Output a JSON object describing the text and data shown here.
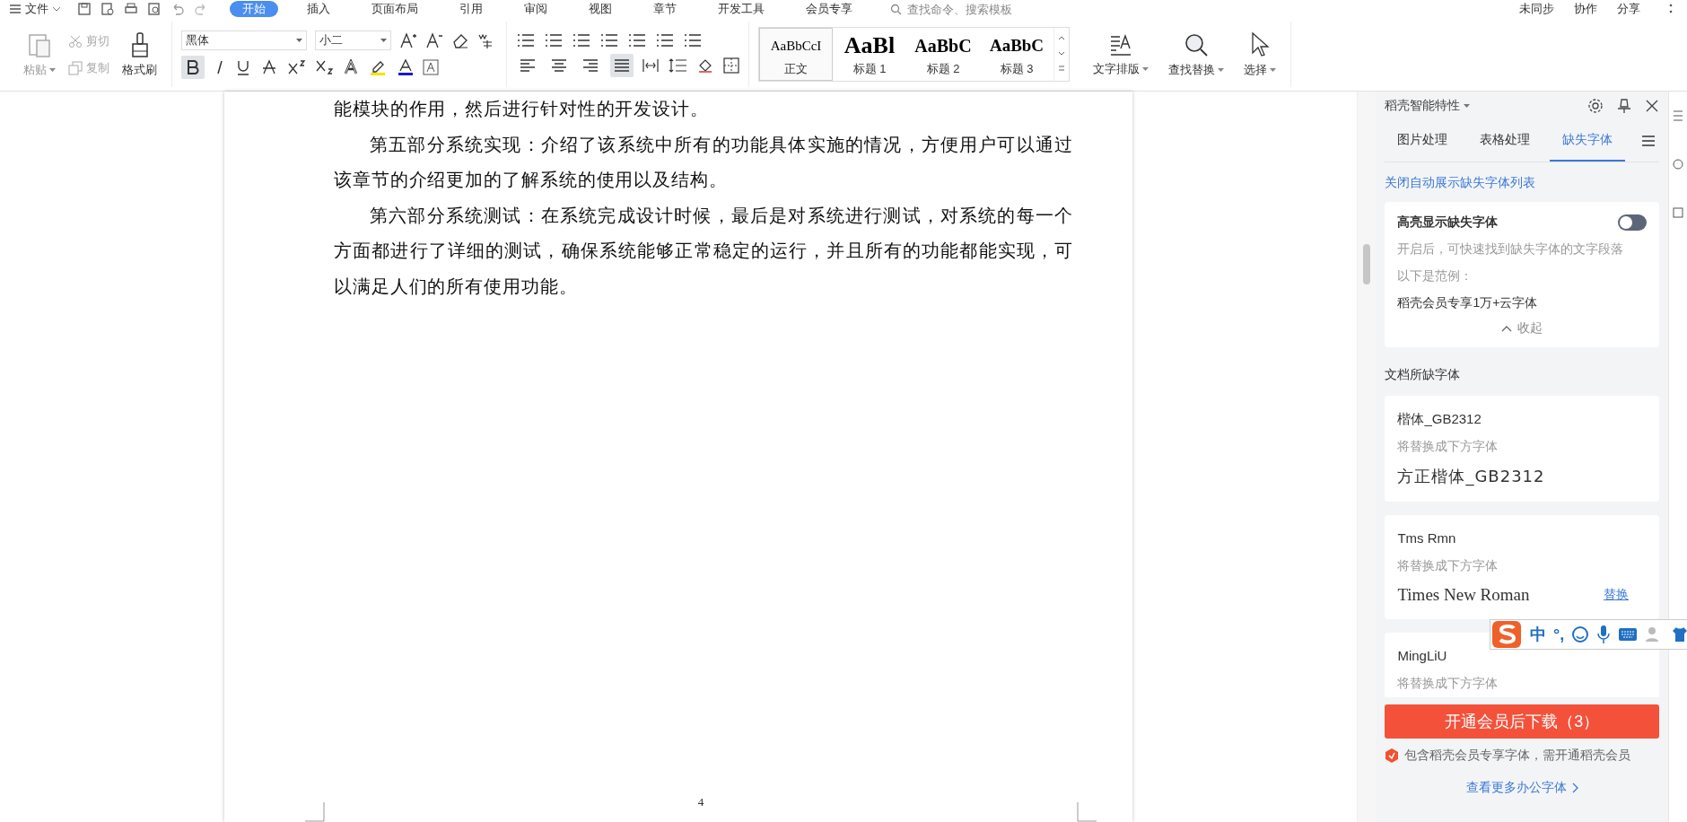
{
  "menu_bar": {
    "file_menu": "文件",
    "tabs": [
      {
        "label": "开始",
        "selected": true
      },
      {
        "label": "插入",
        "selected": false
      },
      {
        "label": "页面布局",
        "selected": false
      },
      {
        "label": "引用",
        "selected": false
      },
      {
        "label": "审阅",
        "selected": false
      },
      {
        "label": "视图",
        "selected": false
      },
      {
        "label": "章节",
        "selected": false
      },
      {
        "label": "开发工具",
        "selected": false
      },
      {
        "label": "会员专享",
        "selected": false
      }
    ],
    "search": {
      "placeholder": "查找命令、搜索模板"
    },
    "actions": [
      "未同步",
      "协作",
      "分享"
    ]
  },
  "ribbon": {
    "paste": "粘贴",
    "cut": {
      "label": "剪切",
      "disabled": true
    },
    "copy": {
      "label": "复制",
      "disabled": true
    },
    "format_painter": "格式刷",
    "font_name": "黑体",
    "font_size": "小二",
    "bold": true,
    "alignments": [
      {
        "kind": "left",
        "selected": false
      },
      {
        "kind": "center",
        "selected": false
      },
      {
        "kind": "right",
        "selected": false
      },
      {
        "kind": "justify",
        "selected": true
      }
    ],
    "styles": [
      {
        "sample": "AaBbCcI",
        "label": "正文",
        "kind": "body",
        "selected": true
      },
      {
        "sample": "AaBl",
        "label": "标题 1",
        "kind": "h1",
        "selected": false
      },
      {
        "sample": "AaBbC",
        "label": "标题 2",
        "kind": "h2",
        "selected": false
      },
      {
        "sample": "AaBbC",
        "label": "标题 3",
        "kind": "h3",
        "selected": false
      }
    ],
    "text_layout": "文字排版",
    "find_replace": "查找替换",
    "select": "选择"
  },
  "document": {
    "paragraphs": [
      {
        "text": "能模块的作用，然后进行针对性的开发设计。",
        "indent": false
      },
      {
        "text": "第五部分系统实现：介绍了该系统中所有的功能具体实施的情况，方便用户可以通过该章节的介绍更加的了解系统的使用以及结构。",
        "indent": true
      },
      {
        "text": "第六部分系统测试：在系统完成设计时候，最后是对系统进行测试，对系统的每一个方面都进行了详细的测试，确保系统能够正常稳定的运行，并且所有的功能都能实现，可以满足人们的所有使用功能。",
        "indent": true
      }
    ],
    "page_number": "4"
  },
  "side_panel": {
    "title": "稻壳智能特性",
    "tabs": [
      {
        "label": "图片处理",
        "selected": false
      },
      {
        "label": "表格处理",
        "selected": false
      },
      {
        "label": "缺失字体",
        "selected": true
      }
    ],
    "auto_show_link": "关闭自动展示缺失字体列表",
    "highlight_card": {
      "title": "高亮显示缺失字体",
      "on": false,
      "description": "开启后，可快速找到缺失字体的文字段落",
      "example_label": "以下是范例：",
      "example": "稻壳会员专享1万+云字体",
      "collapse": "收起"
    },
    "missing_fonts_heading": "文档所缺字体",
    "missing_fonts": [
      {
        "name": "楷体_GB2312",
        "hint": "将替换成下方字体",
        "replacement": "方正楷体_GB2312",
        "kind": "kai"
      },
      {
        "name": "Tms Rmn",
        "hint": "将替换成下方字体",
        "replacement": "Times New Roman",
        "kind": "serif",
        "action": "替换"
      },
      {
        "name": "MingLiU",
        "hint": "将替换成下方字体"
      }
    ],
    "download_button": "开通会员后下载（3）",
    "notice": "包含稻壳会员专享字体，需开通稻壳会员",
    "more_link": "查看更多办公字体"
  },
  "ime_toolbar": {
    "mode": "中",
    "punctuation": "°,"
  }
}
